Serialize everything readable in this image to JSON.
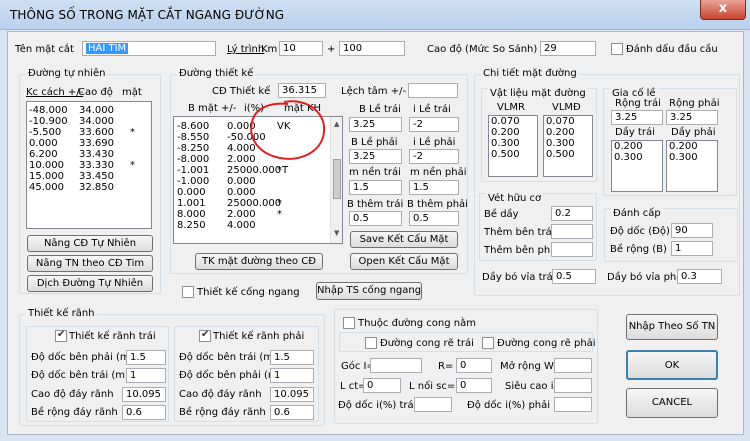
{
  "window": {
    "title": "THÔNG SỐ TRONG MẶT CẮT NGANG ĐƯỜNG",
    "close": "x"
  },
  "top": {
    "ten_mat_cat_label": "Tên mặt cắt",
    "ten_mat_cat_value": "HAI TIM",
    "ly_trinh_label": "Lý trình",
    "km_label": "Km",
    "km_value": "10",
    "plus": "+",
    "plus_value": "100",
    "cao_do_label": "Cao độ (Mức So Sánh)",
    "cao_do_value": "29",
    "danh_dau_label": "Đánh dấu đầu cầu"
  },
  "dtn": {
    "title": "Đường tự nhiên",
    "headers": [
      "Kc cách +/-",
      "Cao độ",
      "mặt"
    ],
    "rows": [
      [
        "-48.000",
        "34.000",
        ""
      ],
      [
        "-10.900",
        "34.000",
        ""
      ],
      [
        "-5.500",
        "33.600",
        "*"
      ],
      [
        "0.000",
        "33.690",
        ""
      ],
      [
        "6.200",
        "33.430",
        ""
      ],
      [
        "10.000",
        "33.330",
        "*"
      ],
      [
        "15.000",
        "33.450",
        ""
      ],
      [
        "45.000",
        "32.850",
        ""
      ]
    ],
    "btn_nang_cd": "Nâng CĐ Tự Nhiên",
    "btn_nang_tn": "Nâng TN theo CĐ Tim",
    "btn_dich": "Dịch Đường Tự Nhiên"
  },
  "dtk": {
    "title": "Đường thiết kế",
    "cd_label": "CĐ Thiết kế",
    "cd_value": "36.315",
    "lech_tam_label": "Lệch tâm +/-",
    "lech_tam_value": "",
    "headers": [
      "B mặt +/-",
      "i(%)",
      "mặt KH"
    ],
    "rows": [
      [
        "-8.600",
        "0.000",
        "VK"
      ],
      [
        "-8.550",
        "-50.000",
        ""
      ],
      [
        "-8.250",
        "4.000",
        ""
      ],
      [
        "-8.000",
        "2.000",
        ""
      ],
      [
        "-1.001",
        "25000.000",
        "*T"
      ],
      [
        "-1.000",
        "0.000",
        ""
      ],
      [
        "0.000",
        "0.000",
        ""
      ],
      [
        "1.001",
        "25000.000",
        "*"
      ],
      [
        "8.000",
        "2.000",
        "*"
      ],
      [
        "8.250",
        "4.000",
        ""
      ]
    ],
    "b_le_trai_label": "B Lề trái",
    "b_le_trai": "3.25",
    "i_le_trai_label": "i Lề trái",
    "i_le_trai": "-2",
    "b_le_phai_label": "B Lề phải",
    "b_le_phai": "3.25",
    "i_le_phai_label": "i Lề phải",
    "i_le_phai": "-2",
    "m_nen_trai_label": "m nền trái",
    "m_nen_trai": "1.5",
    "m_nen_phai_label": "m nền phải",
    "m_nen_phai": "1.5",
    "b_them_trai_label": "B thêm trái",
    "b_them_trai": "0.5",
    "b_them_phai_label": "B thêm phải",
    "b_them_phai": "0.5",
    "btn_save": "Save Kết Cấu Mặt",
    "btn_open": "Open Kết Cấu Mặt",
    "btn_tk": "TK mặt đường theo CĐ",
    "cong_ngang_label": "Thiết kế cống ngang",
    "btn_nhap_ts": "Nhập TS cống ngang"
  },
  "ctmd": {
    "title": "Chi tiết mặt đường",
    "vlmd_title": "Vật liệu mặt đường",
    "vlmr": "VLMR",
    "vlmd": "VLMĐ",
    "vlmr_values": [
      "0.070",
      "0.200",
      "0.300",
      "0.500"
    ],
    "vlmd_values": [
      "0.070",
      "0.200",
      "0.300",
      "0.500"
    ],
    "gcl_title": "Gia cố lề",
    "rong_trai": "Rộng trái",
    "rong_phai": "Rộng phải",
    "rong_trai_value": "3.25",
    "rong_phai_value": "3.25",
    "day_trai": "Dầy trái",
    "day_phai": "Dầy phải",
    "day_trai_values": [
      "0.200",
      "0.300"
    ],
    "day_phai_values": [
      "0.200",
      "0.300"
    ],
    "vhc_title": "Vét hữu cơ",
    "be_day": "Bề dầy",
    "be_day_value": "0.2",
    "them_ben_trai": "Thêm bên trái",
    "them_ben_trai_value": "",
    "them_ben_phai": "Thêm bên phải",
    "them_ben_phai_value": "",
    "dc_title": "Đánh cấp",
    "do_doc": "Độ dốc (Độ)",
    "do_doc_value": "90",
    "be_rong": "Bề rộng (B)",
    "be_rong_value": "1",
    "day_bo_trai": "Dầy bó vỉa trái",
    "day_bo_trai_value": "0.5",
    "day_bo_phai": "Dầy bó vỉa phải",
    "day_bo_phai_value": "0.3"
  },
  "rtk": {
    "title": "Thiết kế rãnh",
    "trai_label": "Thiết kế rãnh trái",
    "phai_label": "Thiết kế rãnh phải",
    "l_do_doc_ben_phai": "Độ dốc bên phải (m)",
    "l_do_doc_ben_phai_value": "1.5",
    "l_do_doc_ben_trai": "Độ dốc bên trái (m)",
    "l_do_doc_ben_trai_value": "1",
    "l_cao_do": "Cao độ đáy rãnh",
    "l_cao_do_value": "10.095",
    "l_be_rong": "Bề rộng đáy rãnh",
    "l_be_rong_value": "0.6",
    "r_do_doc_ben_trai": "Độ dốc bên trái (m)",
    "r_do_doc_ben_trai_value": "1.5",
    "r_do_doc_ben_phai": "Độ dốc bên phải (m)",
    "r_do_doc_ben_phai_value": "1",
    "r_cao_do": "Cao độ đáy rãnh",
    "r_cao_do_value": "10.095",
    "r_be_rong": "Bề rộng đáy rãnh",
    "r_be_rong_value": "0.6"
  },
  "curve": {
    "thuoc_label": "Thuộc đường cong nằm",
    "re_trai": "Đường cong rẽ trái",
    "re_phai": "Đường cong rẽ phải",
    "goc": "Góc I=",
    "r": "R=",
    "r_value": "0",
    "mo_rong": "Mở rộng W=",
    "lct": "L ct=",
    "lct_value": "0",
    "l_noi_sc": "L nối sc=",
    "l_noi_sc_value": "0",
    "sieu_cao": "Siêu cao i=",
    "do_doc_trai": "Độ dốc i(%) trái",
    "do_doc_phai": "Độ dốc i(%) phải"
  },
  "right": {
    "btn_nhap": "Nhập Theo Số TN",
    "btn_ok": "OK",
    "btn_cancel": "CANCEL"
  },
  "colors": {
    "selection": "#3399ff",
    "annotation": "#e02020",
    "titlebar": "#c4d8ef"
  }
}
